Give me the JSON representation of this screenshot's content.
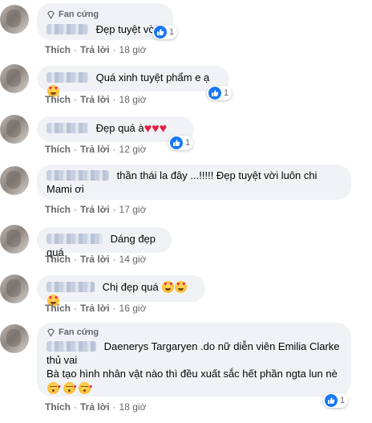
{
  "fan_badge_label": "Fan cứng",
  "action_like": "Thích",
  "action_reply": "Trả lời",
  "separator": "·",
  "comments": [
    {
      "text": "Đẹp tuyệt vời",
      "time": "18 giờ",
      "reaction_count": "1",
      "fan": true
    },
    {
      "text": "Quá xinh tuyệt phẩm e ạ",
      "time": "18 giờ",
      "reaction_count": "1"
    },
    {
      "text": "Đẹp quá à",
      "time": "12 giờ",
      "reaction_count": "1"
    },
    {
      "text": "thần thái la đây ...!!!!! Đẹp tuyệt vời luôn chi Mami ơi",
      "time": "17 giờ"
    },
    {
      "text": "Dáng đẹp quá",
      "time": "14 giờ"
    },
    {
      "text": "Chị đẹp quá",
      "time": "16 giờ"
    },
    {
      "text_line1": "Daenerys Targaryen .do nữ diễn viên Emilia Clarke thủ vai",
      "text_line2": "Bà tạo hình nhân vật nào thì đều xuất sắc hết phần ngta lun nè",
      "time": "18 giờ",
      "reaction_count": "1",
      "fan": true
    }
  ],
  "icons": {
    "fan_badge": "diamond-icon",
    "reaction": "like-thumb-icon",
    "emoji_heart_eyes": "heart-eyes-emoji",
    "emoji_kiss": "kissing-heart-emoji",
    "heart": "red-heart-emoji"
  },
  "colors": {
    "bubble": "#f0f2f5",
    "like_blue": "#1877f2",
    "secondary_text": "#65676b",
    "heart_red": "#e41e3f"
  }
}
